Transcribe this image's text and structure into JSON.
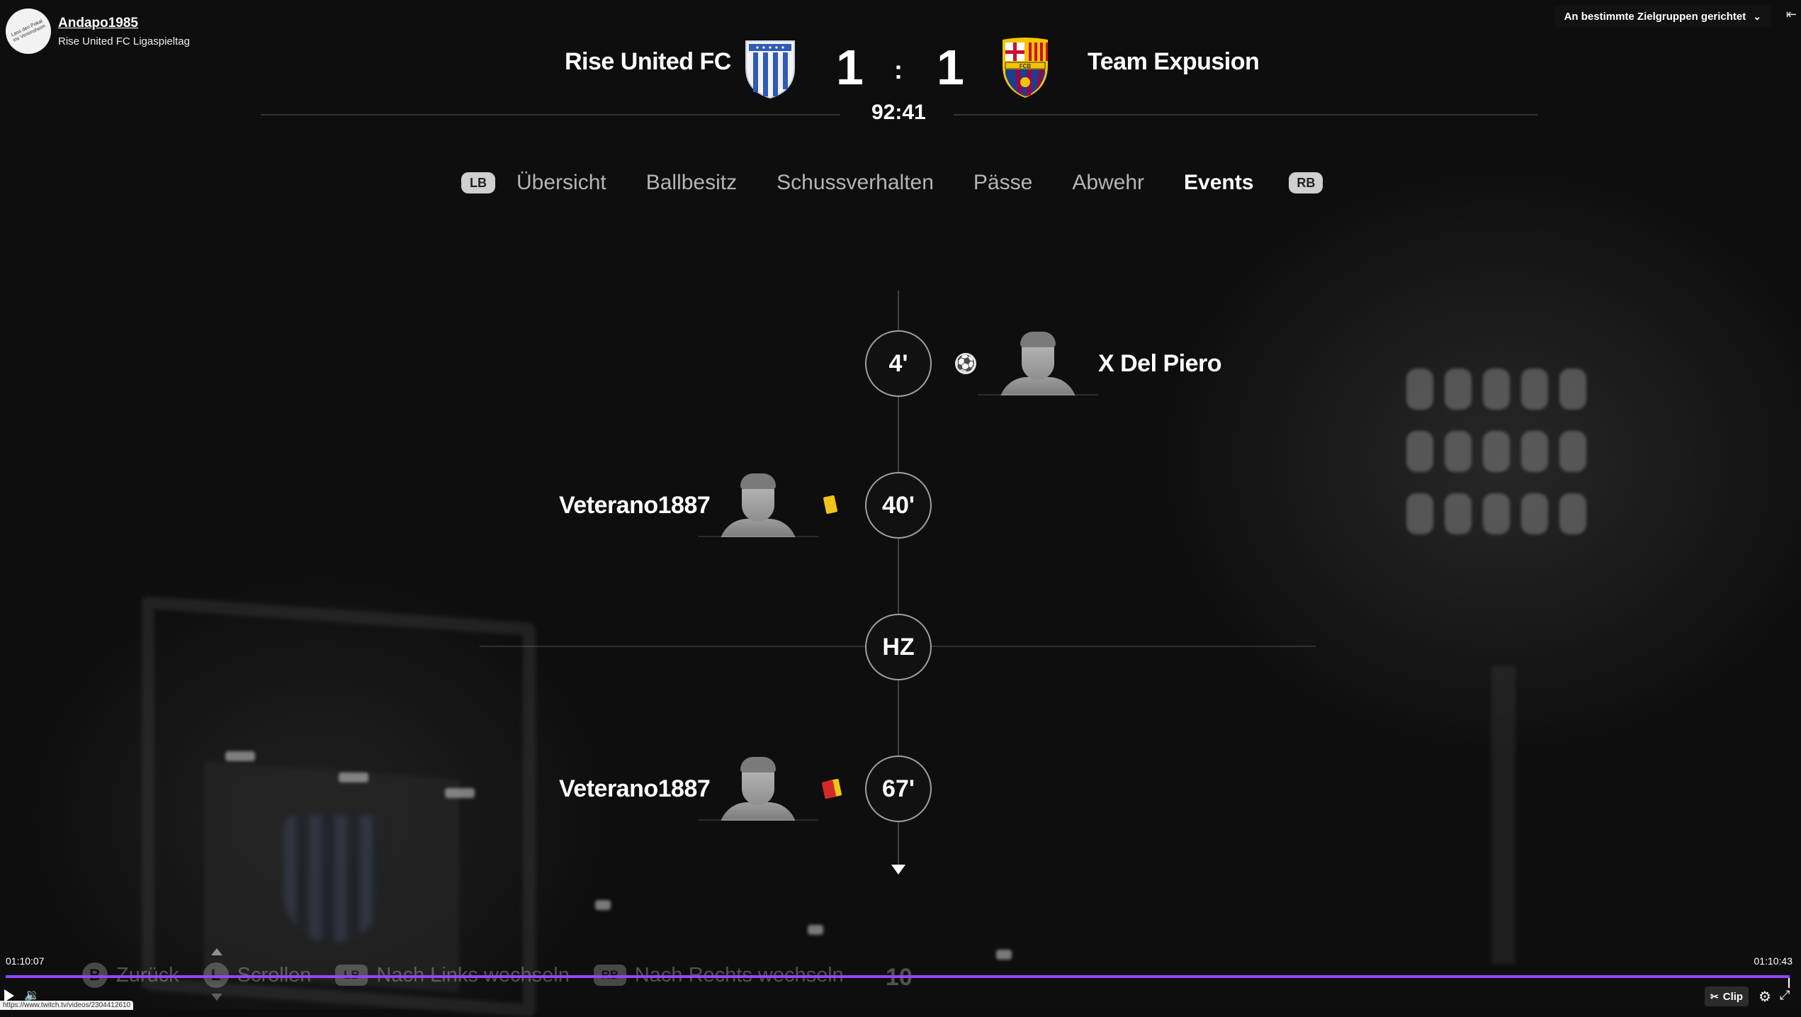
{
  "channel": {
    "name": "Andapo1985",
    "subtitle": "Rise United FC Ligaspieltag",
    "avatar_text": "Lass den Pokal ins Vereinsheim"
  },
  "audience": {
    "label": "An bestimmte Zielgruppen gerichtet"
  },
  "match": {
    "home_team": "Rise United FC",
    "away_team": "Team Expusion",
    "home_score": "1",
    "away_score": "1",
    "separator": ":",
    "clock": "92:41",
    "home_crest_color": "#2f5bb7",
    "away_crest_color": "#a50044"
  },
  "tabs": {
    "lb": "LB",
    "rb": "RB",
    "items": [
      "Übersicht",
      "Ballbesitz",
      "Schussverhalten",
      "Pässe",
      "Abwehr",
      "Events"
    ],
    "active": "Events"
  },
  "events": [
    {
      "minute": "4'",
      "side": "away",
      "player": "X Del Piero",
      "type": "goal",
      "icon": "soccer-ball-icon"
    },
    {
      "minute": "40'",
      "side": "home",
      "player": "Veterano1887",
      "type": "yellow-card",
      "icon": "yellow-card-icon"
    },
    {
      "minute": "HZ",
      "side": "center",
      "type": "halftime"
    },
    {
      "minute": "67'",
      "side": "home",
      "player": "Veterano1887",
      "type": "second-yellow-red",
      "icon": "red-card-icon"
    }
  ],
  "hints": {
    "back_key": "B",
    "back": "Zurück",
    "scroll_key": "L",
    "scroll": "Scrollen",
    "left_key": "LB",
    "left": "Nach Links wechseln",
    "right_key": "RB",
    "right": "Nach Rechts wechseln",
    "number": "10"
  },
  "player": {
    "current_time": "01:10:07",
    "total_time": "01:10:43",
    "progress": 0.995,
    "url": "https://www.twitch.tv/videos/2304412610",
    "clip_label": "Clip",
    "accent": "#9147ff"
  }
}
